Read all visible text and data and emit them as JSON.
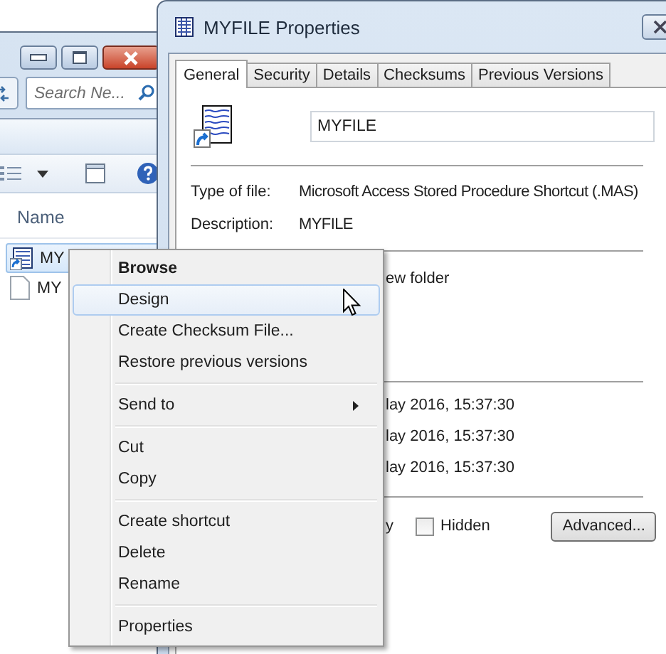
{
  "explorer": {
    "search": {
      "placeholder": "Search Ne..."
    },
    "column": "Name",
    "files": [
      {
        "name": "MY",
        "kind": "shortcut",
        "selected": true
      },
      {
        "name": "MY",
        "kind": "document",
        "selected": false
      }
    ]
  },
  "properties": {
    "title": "MYFILE Properties",
    "tabs": [
      {
        "label": "General",
        "selected": true
      },
      {
        "label": "Security",
        "selected": false
      },
      {
        "label": "Details",
        "selected": false
      },
      {
        "label": "Checksums",
        "selected": false
      },
      {
        "label": "Previous Versions",
        "selected": false
      }
    ],
    "file_name": "MYFILE",
    "fields": [
      {
        "label": "Type of file:",
        "value": "Microsoft Access Stored Procedure Shortcut (.MAS)"
      },
      {
        "label": "Description:",
        "value": "MYFILE"
      }
    ],
    "location": "ew folder",
    "dates": [
      "lay 2016, 15:37:30",
      "lay 2016, 15:37:30",
      "lay 2016, 15:37:30"
    ],
    "attribute_fragment": "y",
    "hidden": {
      "label": "Hidden",
      "checked": false
    },
    "advanced_button": "Advanced..."
  },
  "context_menu": [
    {
      "kind": "item",
      "label": "Browse",
      "bold": true,
      "selected": false
    },
    {
      "kind": "item",
      "label": "Design",
      "bold": false,
      "selected": true
    },
    {
      "kind": "item",
      "label": "Create Checksum File...",
      "bold": false,
      "selected": false
    },
    {
      "kind": "item",
      "label": "Restore previous versions",
      "bold": false,
      "selected": false
    },
    {
      "kind": "separator"
    },
    {
      "kind": "submenu",
      "label": "Send to",
      "bold": false,
      "selected": false
    },
    {
      "kind": "separator"
    },
    {
      "kind": "item",
      "label": "Cut",
      "bold": false,
      "selected": false
    },
    {
      "kind": "item",
      "label": "Copy",
      "bold": false,
      "selected": false
    },
    {
      "kind": "separator"
    },
    {
      "kind": "item",
      "label": "Create shortcut",
      "bold": false,
      "selected": false
    },
    {
      "kind": "item",
      "label": "Delete",
      "bold": false,
      "selected": false
    },
    {
      "kind": "item",
      "label": "Rename",
      "bold": false,
      "selected": false
    },
    {
      "kind": "separator"
    },
    {
      "kind": "item",
      "label": "Properties",
      "bold": false,
      "selected": false
    }
  ]
}
